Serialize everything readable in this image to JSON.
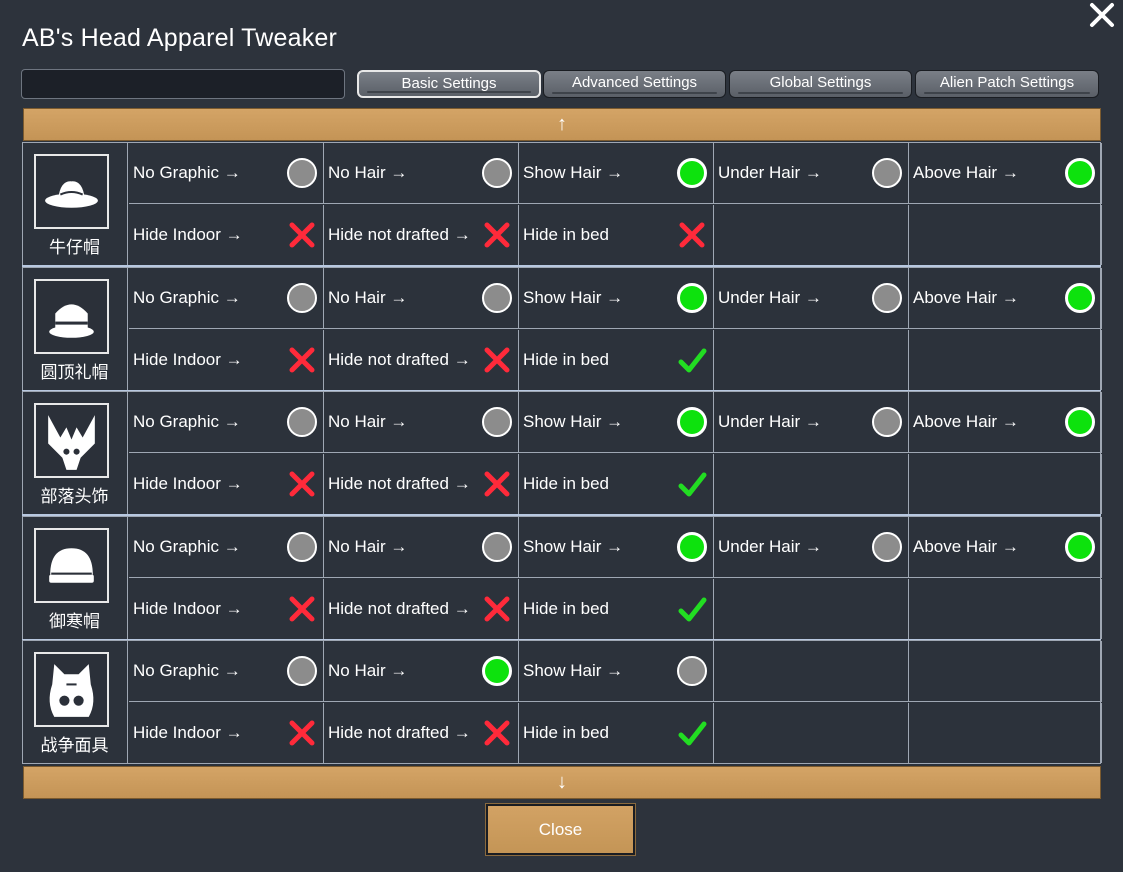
{
  "window": {
    "title": "AB's Head Apparel Tweaker"
  },
  "search": {
    "value": "",
    "placeholder": ""
  },
  "tabs": [
    {
      "label": "Basic Settings",
      "active": true
    },
    {
      "label": "Advanced Settings",
      "active": false
    },
    {
      "label": "Global Settings",
      "active": false
    },
    {
      "label": "Alien Patch Settings",
      "active": false
    }
  ],
  "scroll": {
    "up_label": "↑",
    "down_label": "↓"
  },
  "labels": {
    "no_graphic": "No Graphic →",
    "no_hair": "No Hair →",
    "show_hair": "Show Hair →",
    "under_hair": "Under Hair →",
    "above_hair": "Above Hair →",
    "hide_indoor": "Hide Indoor →",
    "hide_not_drafted": "Hide not drafted →",
    "hide_in_bed": "Hide in bed"
  },
  "apparel": [
    {
      "name": "牛仔帽",
      "icon": "cowboy-hat-icon",
      "graphic": [
        "off",
        "off",
        "on",
        "off",
        "on"
      ],
      "hide_indoor": false,
      "hide_not_drafted": false,
      "hide_in_bed": false
    },
    {
      "name": "圆顶礼帽",
      "icon": "bowler-hat-icon",
      "graphic": [
        "off",
        "off",
        "on",
        "off",
        "on"
      ],
      "hide_indoor": false,
      "hide_not_drafted": false,
      "hide_in_bed": true
    },
    {
      "name": "部落头饰",
      "icon": "tribal-headdress-icon",
      "graphic": [
        "off",
        "off",
        "on",
        "off",
        "on"
      ],
      "hide_indoor": false,
      "hide_not_drafted": false,
      "hide_in_bed": true
    },
    {
      "name": "御寒帽",
      "icon": "tuque-icon",
      "graphic": [
        "off",
        "off",
        "on",
        "off",
        "on"
      ],
      "hide_indoor": false,
      "hide_not_drafted": false,
      "hide_in_bed": true
    },
    {
      "name": "战争面具",
      "icon": "war-mask-icon",
      "graphic": [
        "off",
        "on",
        "off"
      ],
      "hide_indoor": false,
      "hide_not_drafted": false,
      "hide_in_bed": true
    }
  ],
  "footer": {
    "close_label": "Close"
  },
  "colors": {
    "radio_on": "#0de20d",
    "radio_off": "#8c8c8c",
    "cross": "#ff2a3a",
    "check": "#22dd22",
    "button": "#c99a5b"
  }
}
